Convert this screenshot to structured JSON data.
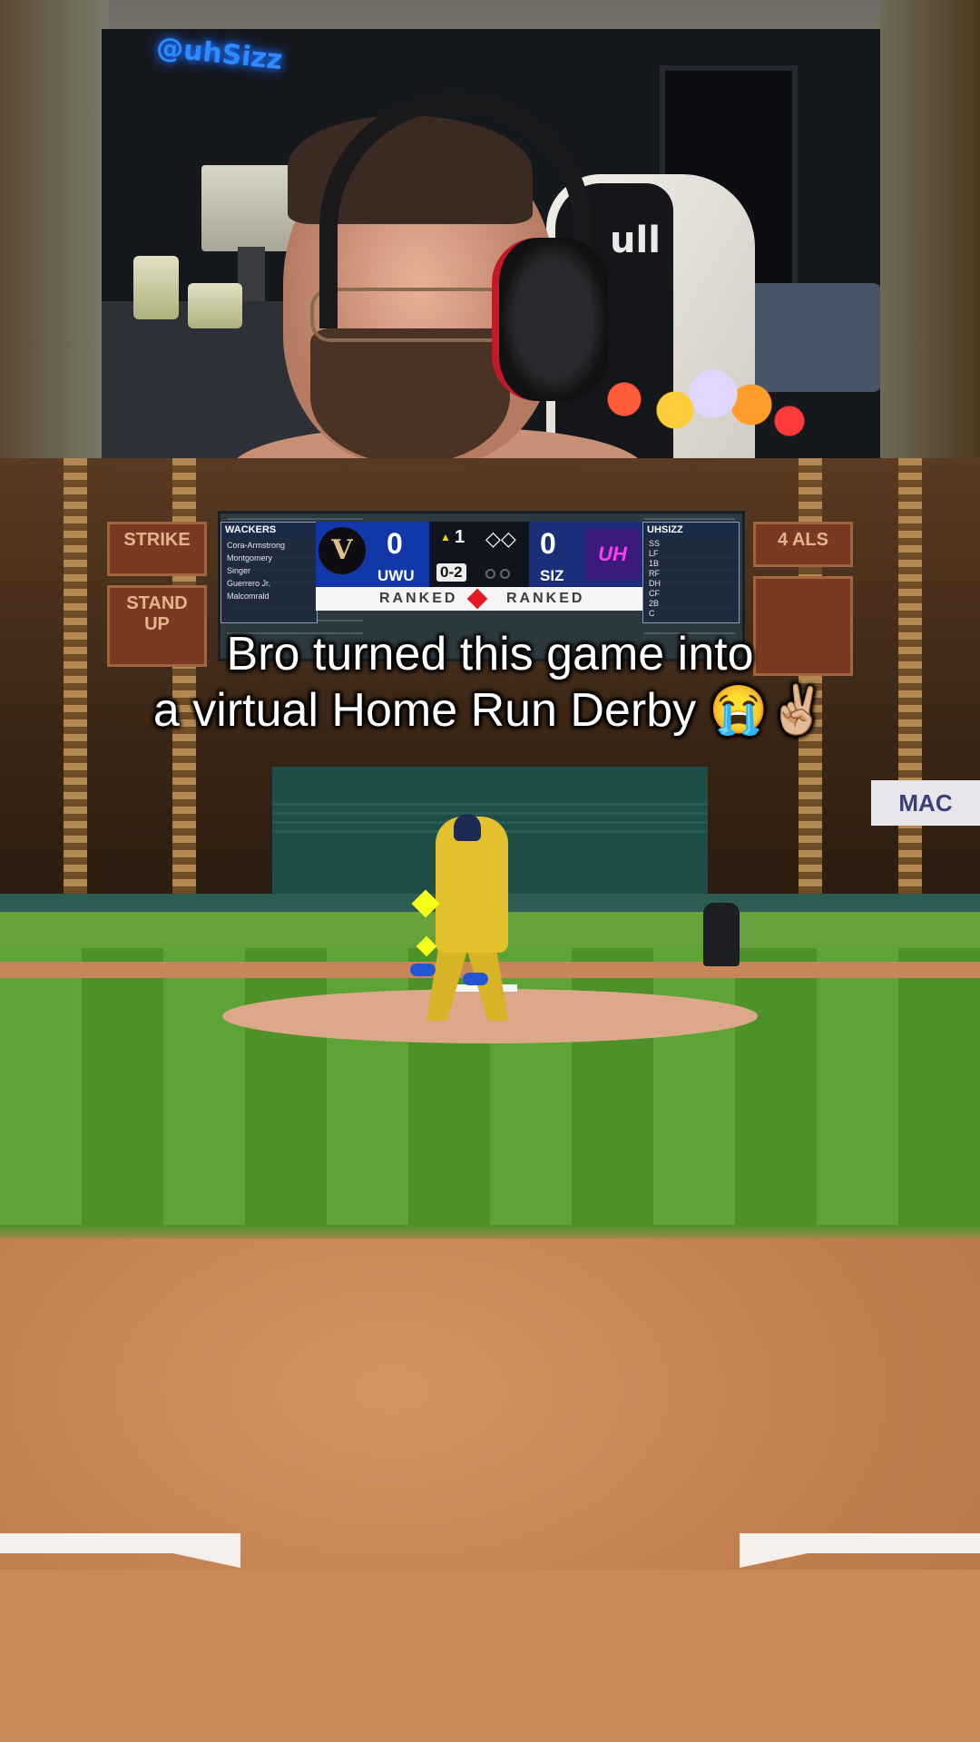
{
  "webcam": {
    "neon_sign": "@uhSizz",
    "chair_brand_text": "ull"
  },
  "stadium": {
    "mac_sign": "MAC",
    "ad_left_1": "STRIKE",
    "ad_left_2": "STAND UP",
    "ad_right_1": "4 ALS"
  },
  "scoreboard": {
    "away_lineup_title": "WACKERS",
    "away_lineup": [
      "Cora-Armstrong",
      "Montgomery",
      "Singer",
      "Guerrero Jr.",
      "Malcomrald"
    ],
    "home_lineup_title": "UHSIZZ",
    "home_lineup": [
      "SS",
      "LF",
      "1B",
      "RF",
      "DH",
      "CF",
      "2B",
      "C"
    ],
    "away_team": "UWU",
    "away_score": "0",
    "home_team": "SIZ",
    "home_score": "0",
    "inning": "1",
    "count": "0-2",
    "away_logo_letter": "V",
    "home_logo_text": "UH",
    "ranked_left": "RANKED",
    "ranked_right": "RANKED"
  },
  "caption": {
    "line1": "Bro turned this game into",
    "line2": "a virtual Home Run Derby 😭✌🏼"
  },
  "colors": {
    "away_team": "#1237a8",
    "home_team": "#1a2e7a",
    "ranked_gem": "#e11a26",
    "grass": "#5ea335",
    "dirt": "#c98a55"
  }
}
